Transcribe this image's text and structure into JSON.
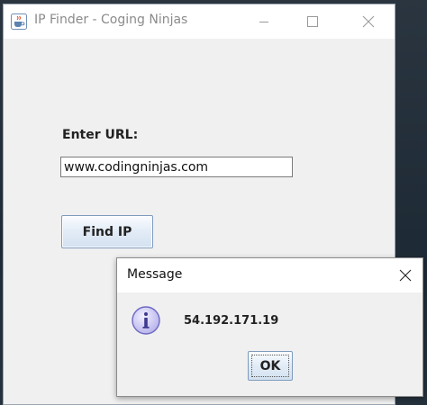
{
  "main_window": {
    "title": "IP Finder - Coging Ninjas",
    "app_icon": "java-cup-icon",
    "controls": [
      "minimize-icon",
      "maximize-icon",
      "close-icon"
    ]
  },
  "form": {
    "url_label": "Enter URL:",
    "url_value": "www.codingninjas.com",
    "find_button_label": "Find IP"
  },
  "dialog": {
    "title": "Message",
    "icon": "info-icon",
    "message": "54.192.171.19",
    "ok_label": "OK"
  },
  "colors": {
    "title_text_inactive": "#8b8b8b",
    "window_bg": "#f0f0f0",
    "button_border": "#7e9bbd",
    "info_icon_fill": "#c9c6f2"
  }
}
